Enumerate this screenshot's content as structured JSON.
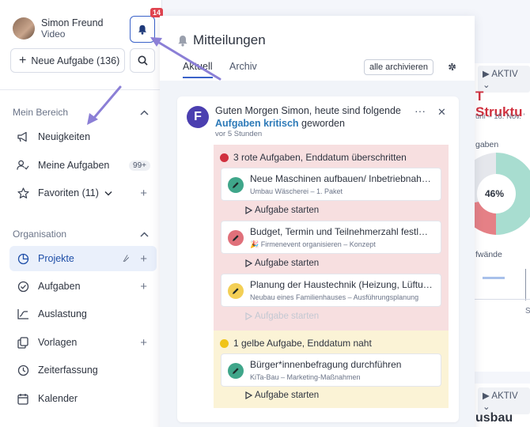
{
  "user": {
    "name": "Simon Freund",
    "role": "Video"
  },
  "notifications_badge": "14",
  "new_task_label": "Neue Aufgabe (136)",
  "sidebar": {
    "section1": "Mein Bereich",
    "items1": [
      {
        "label": "Neuigkeiten",
        "icon": "megaphone-icon"
      },
      {
        "label": "Meine Aufgaben",
        "icon": "user-check-icon",
        "pill": "99+"
      },
      {
        "label": "Favoriten (11)",
        "icon": "star-icon"
      }
    ],
    "section2": "Organisation",
    "items2": [
      {
        "label": "Projekte",
        "icon": "pie-icon"
      },
      {
        "label": "Aufgaben",
        "icon": "check-circle-icon"
      },
      {
        "label": "Auslastung",
        "icon": "chart-icon"
      },
      {
        "label": "Vorlagen",
        "icon": "copy-icon"
      },
      {
        "label": "Zeiterfassung",
        "icon": "clock-icon"
      },
      {
        "label": "Kalender",
        "icon": "calendar-icon"
      }
    ]
  },
  "background": {
    "status1": "AKTIV",
    "status2": "AKTIV",
    "title_fragment": "T Struktu",
    "date_fragment": "uni – 18. Nov. '",
    "label1": "gaben",
    "percent": "46%",
    "label2": "fwände",
    "s_fragment": "S",
    "title2_fragment": "usbau"
  },
  "panel": {
    "title": "Mitteilungen",
    "tabs": [
      "Aktuell",
      "Archiv"
    ],
    "archive_all": "alle archivieren",
    "notification": {
      "logo_letter": "F",
      "text_before": "Guten Morgen Simon, heute sind folgende ",
      "text_highlight": "Aufgaben kritisch",
      "text_after": " geworden",
      "time": "vor 5 Stunden",
      "groups": [
        {
          "color": "#d0303e",
          "heading": "3 rote Aufgaben, Enddatum überschritten",
          "tasks": [
            {
              "title": "Neue Maschinen aufbauen/ Inbetriebnah…",
              "sub": "Umbau Wäscherei – 1. Paket",
              "icon_bg": "#3fa68a",
              "start": "Aufgabe starten",
              "disabled": false
            },
            {
              "title": "Budget, Termin und Teilnehmerzahl festl…",
              "sub": "🎉 Firmenevent organisieren – Konzept",
              "icon_bg": "#e0707a",
              "start": "Aufgabe starten",
              "disabled": false
            },
            {
              "title": "Planung der Haustechnik (Heizung, Lüftu…",
              "sub": "Neubau eines Familienhauses – Ausführungsplanung",
              "icon_bg": "#f3cf55",
              "start": "Aufgabe starten",
              "disabled": true
            }
          ]
        },
        {
          "color": "#f0c419",
          "heading": "1 gelbe Aufgabe, Enddatum naht",
          "tasks": [
            {
              "title": "Bürger*innenbefragung durchführen",
              "sub": "KiTa-Bau – Marketing-Maßnahmen",
              "icon_bg": "#3fa68a",
              "start": "Aufgabe starten",
              "disabled": false
            }
          ]
        }
      ]
    }
  },
  "colors": {
    "accent": "#3a62c9",
    "arrow": "#8b7fd6",
    "active_nav": "#eaf0fb"
  }
}
